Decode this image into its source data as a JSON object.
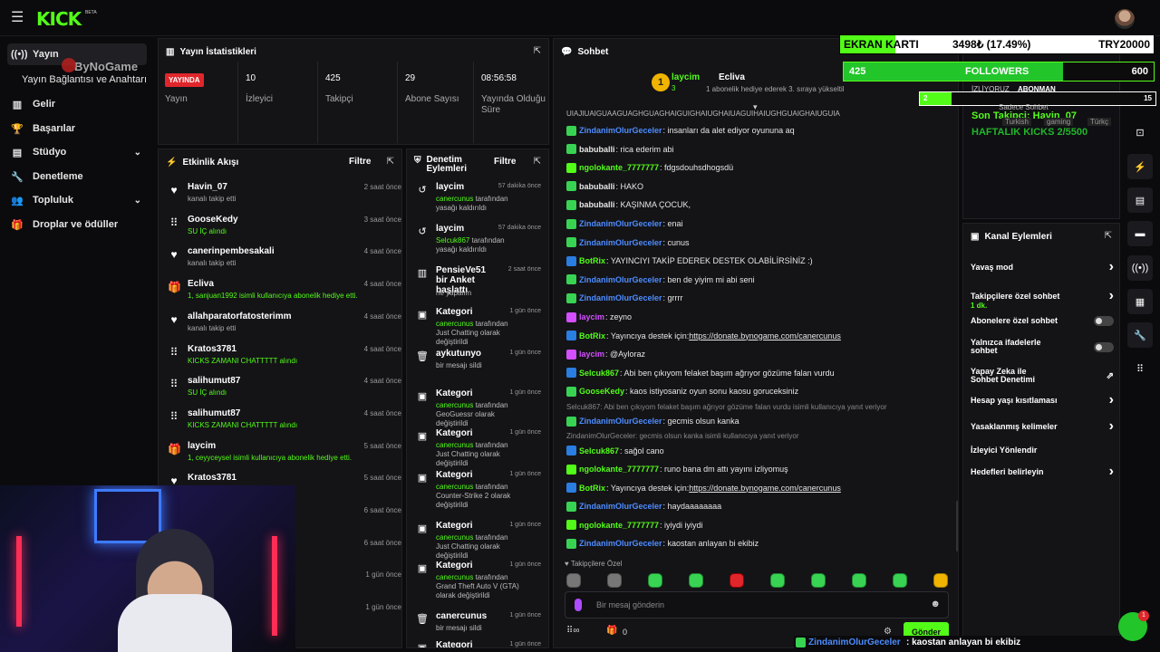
{
  "brand": {
    "logo": "KICK",
    "beta": "BETA",
    "accent": "#53fc18"
  },
  "sidebar": {
    "items": [
      {
        "label": "Yayın",
        "icon": "broadcast-icon"
      },
      {
        "label": "Yayın Bağlantısı ve Anahtarı"
      },
      {
        "label": "Gelir",
        "icon": "chart-icon"
      },
      {
        "label": "Başarılar",
        "icon": "trophy-icon"
      },
      {
        "label": "Stüdyo",
        "icon": "studio-icon"
      },
      {
        "label": "Denetleme",
        "icon": "wrench-icon"
      },
      {
        "label": "Topluluk",
        "icon": "community-icon"
      },
      {
        "label": "Droplar ve ödüller",
        "icon": "gift-icon"
      }
    ]
  },
  "watermark": "ByNoGame",
  "stats": {
    "title": "Yayın İstatistikleri",
    "live_badge": "YAYINDA",
    "items": [
      {
        "label": "Yayın"
      },
      {
        "value": "10",
        "label": "İzleyici"
      },
      {
        "value": "425",
        "label": "Takipçi"
      },
      {
        "value": "29",
        "label": "Abone Sayısı"
      },
      {
        "value": "08:56:58",
        "label": "Yayında Olduğu Süre"
      }
    ]
  },
  "activity": {
    "title": "Etkinlik Akışı",
    "filter": "Filtre",
    "items": [
      {
        "icon": "heart-icon",
        "name": "Havin_07",
        "desc": "kanalı takip etti",
        "time": "2 saat önce",
        "green": false
      },
      {
        "icon": "share-icon",
        "name": "GooseKedy",
        "desc": "SU İÇ alındı",
        "time": "3 saat önce",
        "green": true
      },
      {
        "icon": "heart-icon",
        "name": "canerinpembesakali",
        "desc": "kanalı takip etti",
        "time": "4 saat önce",
        "green": false
      },
      {
        "icon": "gift-icon",
        "name": "Ecliva",
        "desc": "1, sanjuan1992 isimli kullanıcıya abonelik hediye etti.",
        "time": "4 saat önce",
        "green": true
      },
      {
        "icon": "heart-icon",
        "name": "allahparatorfatosterimm",
        "desc": "kanalı takip etti",
        "time": "4 saat önce",
        "green": false
      },
      {
        "icon": "share-icon",
        "name": "Kratos3781",
        "desc": "KICKS ZAMANI CHATTTTT alındı",
        "time": "4 saat önce",
        "green": true
      },
      {
        "icon": "share-icon",
        "name": "salihumut87",
        "desc": "SU İÇ alındı",
        "time": "4 saat önce",
        "green": true
      },
      {
        "icon": "share-icon",
        "name": "salihumut87",
        "desc": "KICKS ZAMANI CHATTTTT alındı",
        "time": "4 saat önce",
        "green": true
      },
      {
        "icon": "gift-icon",
        "name": "laycim",
        "desc": "1, ceyyceysel isimli kullanıcıya abonelik hediye etti.",
        "time": "5 saat önce",
        "green": true
      },
      {
        "icon": "heart-icon",
        "name": "Kratos3781",
        "desc": "",
        "time": "5 saat önce",
        "green": false
      },
      {
        "icon": "",
        "name": "",
        "desc": "",
        "time": "6 saat önce",
        "green": false
      },
      {
        "icon": "",
        "name": "",
        "desc": "",
        "time": "6 saat önce",
        "green": false
      },
      {
        "icon": "",
        "name": "",
        "desc": "",
        "time": "1 gün önce",
        "green": false
      },
      {
        "icon": "",
        "name": "",
        "desc": "",
        "time": "1 gün önce",
        "green": false
      }
    ]
  },
  "moderation": {
    "title": "Denetim Eylemleri",
    "filter": "Filtre",
    "items": [
      {
        "icon": "undo-icon",
        "name": "laycim",
        "user": "canercunus",
        "desc": " tarafından yasağı kaldırıldı",
        "time": "57 dakika önce"
      },
      {
        "icon": "undo-icon",
        "name": "laycim",
        "user": "Selcuk867",
        "desc": " tarafından yasağı kaldırıldı",
        "time": "57 dakika önce"
      },
      {
        "icon": "poll-icon",
        "name": "PensieVe51 bir Anket başlattı",
        "user": "",
        "desc": "ne yapalım",
        "time": "2 saat önce"
      },
      {
        "icon": "category-icon",
        "name": "Kategori",
        "user": "canercunus",
        "desc": " tarafından Just Chatting olarak değiştirildi",
        "time": "1 gün önce"
      },
      {
        "icon": "trash-icon",
        "name": "aykutunyo",
        "user": "",
        "desc": "bir mesajı sildi",
        "time": "1 gün önce"
      },
      {
        "icon": "category-icon",
        "name": "Kategori",
        "user": "canercunus",
        "desc": " tarafından GeoGuessr olarak değiştirildi",
        "time": "1 gün önce"
      },
      {
        "icon": "category-icon",
        "name": "Kategori",
        "user": "canercunus",
        "desc": " tarafından Just Chatting olarak değiştirildi",
        "time": "1 gün önce"
      },
      {
        "icon": "category-icon",
        "name": "Kategori",
        "user": "canercunus",
        "desc": " tarafından Counter-Strike 2 olarak değiştirildi",
        "time": "1 gün önce"
      },
      {
        "icon": "category-icon",
        "name": "Kategori",
        "user": "canercunus",
        "desc": " tarafından Just Chatting olarak değiştirildi",
        "time": "1 gün önce"
      },
      {
        "icon": "category-icon",
        "name": "Kategori",
        "user": "canercunus",
        "desc": " tarafından Grand Theft Auto V (GTA) olarak değiştirildi",
        "time": "1 gün önce"
      },
      {
        "icon": "trash-icon",
        "name": "canercunus",
        "user": "",
        "desc": "bir mesajı sildi",
        "time": "1 gün önce"
      },
      {
        "icon": "category-icon",
        "name": "Kategori",
        "user": "",
        "desc": "",
        "time": "1 gün önce"
      }
    ]
  },
  "chat": {
    "title": "Sohbet",
    "pinned": {
      "user1": "laycim",
      "count": "3",
      "user2": "Ecliva",
      "text": "1 abonelik hediye ederek 3. sıraya yükseltil"
    },
    "top_overflow": "UIAJIUAIGUAAGUAGHGUAGHAIGUIGHAIUGHAIUAGUIHAIUGHGUAIGHAIUGUIA",
    "messages": [
      {
        "user": "ZindanimOlurGeceler",
        "color": "#4d8cff",
        "icon": "#39d353",
        "text": ": insanları da alet ediyor oyununa aq",
        "reply": ""
      },
      {
        "user": "babuballi",
        "color": "#e6e6e6",
        "icon": "#39d353",
        "text": ": rica ederim abi",
        "reply": ""
      },
      {
        "user": "ngolokante_7777777",
        "color": "#53fc18",
        "icon": "#53fc18",
        "text": ": fdgsdouhsdhogsdü",
        "reply": ""
      },
      {
        "user": "babuballi",
        "color": "#e6e6e6",
        "icon": "#39d353",
        "text": ": HAKO",
        "reply": ""
      },
      {
        "user": "babuballi",
        "color": "#e6e6e6",
        "icon": "#39d353",
        "text": ": KAŞINMA ÇOCUK,",
        "reply": ""
      },
      {
        "user": "ZindanimOlurGeceler",
        "color": "#4d8cff",
        "icon": "#39d353",
        "text": ": enai",
        "reply": ""
      },
      {
        "user": "ZindanimOlurGeceler",
        "color": "#4d8cff",
        "icon": "#39d353",
        "text": ": cunus",
        "reply": ""
      },
      {
        "user": "BotRix",
        "color": "#53fc18",
        "icon": "#2a7de1",
        "text": ": YAYINCIYI TAKİP EDEREK DESTEK OLABİLİRSİNİZ :)",
        "reply": ""
      },
      {
        "user": "ZindanimOlurGeceler",
        "color": "#4d8cff",
        "icon": "#39d353",
        "text": ": ben de yiyim mi abi seni",
        "reply": ""
      },
      {
        "user": "ZindanimOlurGeceler",
        "color": "#4d8cff",
        "icon": "#39d353",
        "text": ": grrrr",
        "reply": ""
      },
      {
        "user": "laycim",
        "color": "#d34fff",
        "icon": "#d34fff",
        "text": ": zeyno",
        "reply": ""
      },
      {
        "user": "BotRix",
        "color": "#53fc18",
        "icon": "#2a7de1",
        "text": ": Yayıncıya destek için: ",
        "link": "https://donate.bynogame.com/canercunus",
        "reply": ""
      },
      {
        "user": "laycim",
        "color": "#d34fff",
        "icon": "#d34fff",
        "text": ": @Ayloraz",
        "reply": ""
      },
      {
        "user": "Selcuk867",
        "color": "#53fc18",
        "icon": "#2a7de1",
        "text": ": Abi ben çıkıyom felaket başım ağrıyor gözüme falan vurdu",
        "reply": ""
      },
      {
        "user": "GooseKedy",
        "color": "#53fc18",
        "icon": "#39d353",
        "text": ": kaos istiyosaniz oyun sonu kaosu goruceksiniz",
        "reply": ""
      },
      {
        "user": "ZindanimOlurGeceler",
        "color": "#4d8cff",
        "icon": "#39d353",
        "text": ": gecmis olsun kanka",
        "reply": "Selcuk867: Abi ben çıkıyom felaket başım ağrıyor gözüme falan vurdu isimli kullanıcıya yanıt veriyor"
      },
      {
        "user": "Selcuk867",
        "color": "#53fc18",
        "icon": "#2a7de1",
        "text": ": sağol cano",
        "reply": "ZindanimOlurGeceler: gecmis olsun kanka isimli kullanıcıya yanıt veriyor"
      },
      {
        "user": "ngolokante_7777777",
        "color": "#53fc18",
        "icon": "#53fc18",
        "text": ": runo bana dm attı yayını izliyomuş",
        "reply": ""
      },
      {
        "user": "BotRix",
        "color": "#53fc18",
        "icon": "#2a7de1",
        "text": ": Yayıncıya destek için: ",
        "link": "https://donate.bynogame.com/canercunus",
        "reply": ""
      },
      {
        "user": "ZindanimOlurGeceler",
        "color": "#4d8cff",
        "icon": "#39d353",
        "text": ": haydaaaaaaaa",
        "reply": ""
      },
      {
        "user": "ngolokante_7777777",
        "color": "#53fc18",
        "icon": "#53fc18",
        "text": ": iyiydi iyiydi",
        "reply": ""
      },
      {
        "user": "ZindanimOlurGeceler",
        "color": "#4d8cff",
        "icon": "#39d353",
        "text": ": kaostan anlayan bi ekibiz",
        "reply": ""
      }
    ],
    "followers_only": "Takipçilere Özel",
    "input_placeholder": "Bir mesaj gönderin",
    "points": "0",
    "send_label": "Gönder"
  },
  "channel_actions": {
    "title": "Kanal Eylemleri",
    "items": [
      {
        "label": "Yavaş mod",
        "control": "chevron"
      },
      {
        "label": "Takipçilere özel sohbet",
        "sub": "1 dk.",
        "control": "chevron"
      },
      {
        "label": "Abonelere özel sohbet",
        "control": "toggle"
      },
      {
        "label": "Yalnızca ifadelerle sohbet",
        "control": "toggle"
      },
      {
        "label": "Yapay Zeka ile Sohbet Denetimi",
        "control": "external"
      },
      {
        "label": "Hesap yaşı kısıtlaması",
        "control": "chevron"
      },
      {
        "label": "Yasaklanmış kelimeler",
        "control": "chevron"
      },
      {
        "label": "İzleyici Yönlendir",
        "control": "none"
      },
      {
        "label": "Hedefleri belirleyin",
        "control": "chevron"
      }
    ]
  },
  "overlay": {
    "ekran_label": "EKRAN KARTI",
    "ekran_amount": "3498₺ (17.49%)",
    "ekran_target": "TRY20000",
    "ekran_progress": 0.1749,
    "followers_current": "425",
    "followers_label": "FOLLOWERS",
    "followers_target": "600",
    "followers_progress": 0.708,
    "sub_text": "İZLİYORUZ",
    "sub_label": "ABONMAN",
    "sub_current": "2",
    "sub_target": "15",
    "sub_progress": 0.133,
    "mini_chat": "Sadece Sohbet",
    "tags": [
      "Turkish",
      "gaming",
      "Türkç"
    ],
    "last_follower": "Son Takipçi: Havin_07",
    "weekly_kicks": "HAFTALIK KICKS 2/5500",
    "bottom_ticker_user": "ZindanimOlurGeceler",
    "bottom_ticker_text": ": kaostan anlayan bi ekibiz",
    "notif_count": "1"
  }
}
